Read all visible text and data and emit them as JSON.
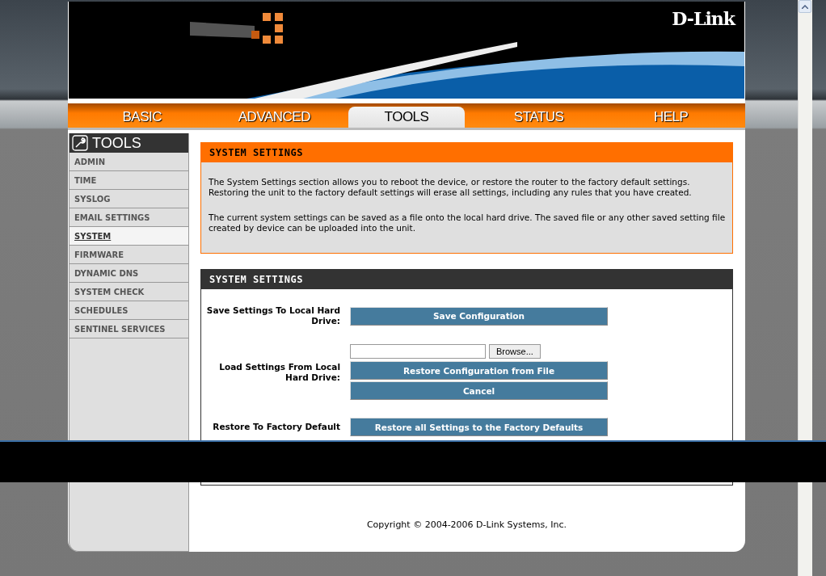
{
  "logo": "D-Link",
  "nav_tabs": [
    {
      "label": "BASIC",
      "selected": false
    },
    {
      "label": "ADVANCED",
      "selected": false
    },
    {
      "label": "TOOLS",
      "selected": true
    },
    {
      "label": "STATUS",
      "selected": false
    },
    {
      "label": "HELP",
      "selected": false
    }
  ],
  "sidebar": {
    "title": "TOOLS",
    "items": [
      {
        "label": "ADMIN",
        "selected": false
      },
      {
        "label": "TIME",
        "selected": false
      },
      {
        "label": "SYSLOG",
        "selected": false
      },
      {
        "label": "EMAIL SETTINGS",
        "selected": false
      },
      {
        "label": "SYSTEM",
        "selected": true
      },
      {
        "label": "FIRMWARE",
        "selected": false
      },
      {
        "label": "DYNAMIC DNS",
        "selected": false
      },
      {
        "label": "SYSTEM CHECK",
        "selected": false
      },
      {
        "label": "SCHEDULES",
        "selected": false
      },
      {
        "label": "SENTINEL SERVICES",
        "selected": false
      }
    ]
  },
  "intro": {
    "title": "SYSTEM SETTINGS",
    "paragraphs": [
      "The System Settings section allows you to reboot the device, or restore the router to the factory default settings. Restoring the unit to the factory default settings will erase all settings, including any rules that you have created.",
      "The current system settings can be saved as a file onto the local hard drive. The saved file or any other saved setting file created by device can be uploaded into the unit."
    ]
  },
  "settings": {
    "title": "SYSTEM SETTINGS",
    "rows": [
      {
        "label": "Save Settings To Local Hard Drive:",
        "buttons": [
          "Save Configuration"
        ]
      },
      {
        "label": "Load Settings From Local Hard Drive:",
        "file_button": "Browse...",
        "buttons": [
          "Restore Configuration from File",
          "Cancel"
        ]
      },
      {
        "label": "Restore To Factory Default",
        "buttons": [
          "Restore all Settings to the Factory Defaults"
        ]
      }
    ]
  },
  "copyright": "Copyright © 2004-2006 D-Link Systems, Inc."
}
